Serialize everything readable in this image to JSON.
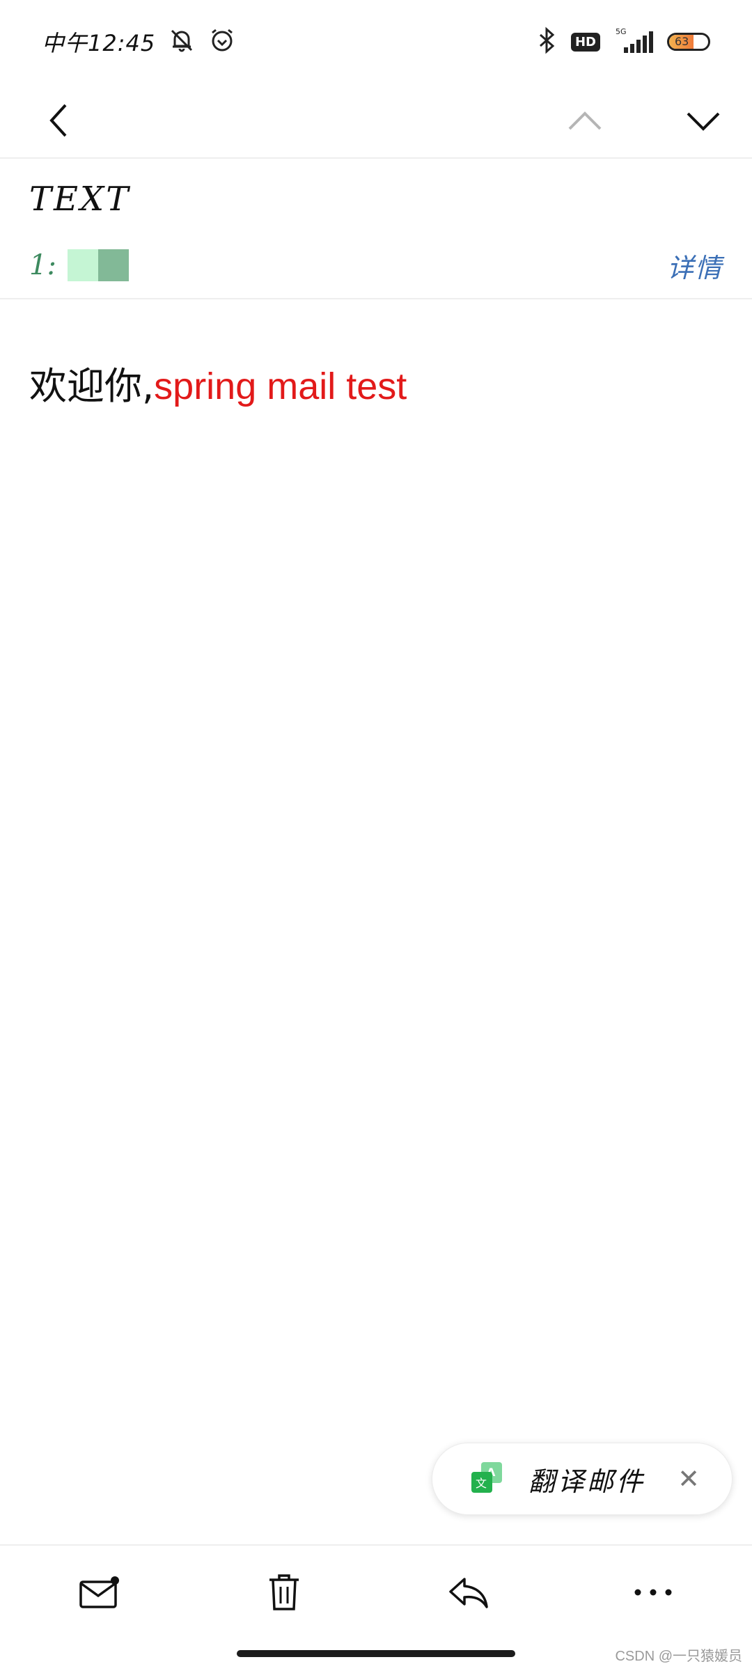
{
  "status_bar": {
    "time": "中午12:45",
    "network": "5G",
    "hd_label": "HD",
    "battery_percent": "63",
    "icons": [
      "mute-bell-icon",
      "alarm-icon",
      "bluetooth-icon",
      "signal-icon",
      "battery-icon"
    ]
  },
  "nav": {
    "icons": [
      "back-arrow-icon",
      "chevron-up-icon",
      "chevron-down-icon"
    ]
  },
  "mail": {
    "subject": "TEXT",
    "sender_partial": "1:",
    "details_label": "详情",
    "body_prefix": "欢迎你,",
    "body_highlight": "spring mail test",
    "highlight_color": "#e21a1a"
  },
  "translate_toast": {
    "label": "翻译邮件",
    "close_glyph": "✕",
    "icon_letters": {
      "front": "文",
      "back": "A"
    }
  },
  "toolbar": {
    "icons": [
      "mail-unread-icon",
      "trash-icon",
      "reply-icon",
      "more-icon"
    ]
  },
  "watermark": "CSDN @一只猿媛员"
}
